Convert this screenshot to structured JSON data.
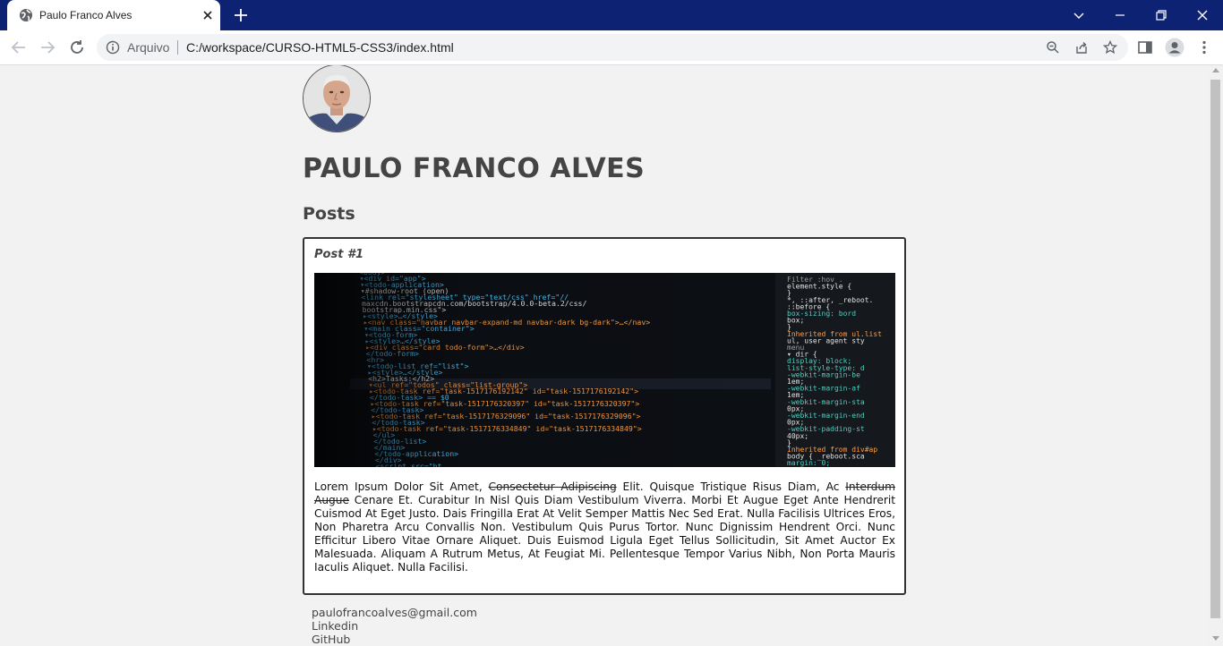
{
  "browser": {
    "tab_title": "Paulo Franco Alves",
    "scheme_label": "Arquivo",
    "url": "C:/workspace/CURSO-HTML5-CSS3/index.html"
  },
  "page": {
    "name": "PAULO FRANCO ALVES",
    "posts_heading": "Posts",
    "post": {
      "title": "Post #1",
      "text_parts": [
        "Lorem Ipsum Dolor Sit Amet, ",
        "Consectetur Adipiscing",
        " Elit. Quisque Tristique Risus Diam, Ac ",
        "Interdum Augue",
        " Cenare Et. Curabitur In Nisl Quis Diam Vestibulum Viverra. Morbi Et Augue Eget Ante Hendrerit Cuismod At Eget Justo. Dais Fringilla Erat At Velit Semper Mattis Nec Sed Erat. Nulla Facilisis Ultrices Eros, Non Pharetra Arcu Convallis Non. Vestibulum Quis Purus Tortor. Nunc Dignissim Hendrent Orci. Nunc Efficitur Libero Vitae Ornare Aliquet. Duis Euismod Ligula Eget Tellus Sollicitudin, Sit Amet Auctor Ex Malesuada. Aliquam A Rutrum Metus, At Feugiat Mi. Pellentesque Tempor Varius Nibh, Non Porta Mauris Iaculis Aliquet. Nulla Facilisi."
      ],
      "code_lines": [
        {
          "text": "<body>",
          "color": "#4fc3f7"
        },
        {
          "text": "▾<div id=\"app\">",
          "color": "#4fc3f7"
        },
        {
          "text": "  ▾<todo-application>",
          "color": "#4fc3f7"
        },
        {
          "text": "    ▾#shadow-root (open)",
          "color": "#e0e0e0"
        },
        {
          "text": "      <link rel=\"stylesheet\" type=\"text/css\" href=\"//",
          "color": "#4fc3f7"
        },
        {
          "text": "      maxcdn.bootstrapcdn.com/bootstrap/4.0.0-beta.2/css/",
          "color": "#e0e0e0"
        },
        {
          "text": "      bootstrap.min.css\">",
          "color": "#e0e0e0"
        },
        {
          "text": "     ▸<style>…</style>",
          "color": "#4fc3f7"
        },
        {
          "text": "     ▸<nav class=\"navbar navbar-expand-md navbar-dark bg-dark\">…</nav>",
          "color": "#ff9e40"
        },
        {
          "text": "     ▾<main class=\"container\">",
          "color": "#4fc3f7"
        },
        {
          "text": "       ▾<todo-form>",
          "color": "#4fc3f7"
        },
        {
          "text": "         ▸<style>…</style>",
          "color": "#4fc3f7"
        },
        {
          "text": "         ▸<div class=\"card todo-form\">…</div>",
          "color": "#ff9e40"
        },
        {
          "text": "        </todo-form>",
          "color": "#4fc3f7"
        },
        {
          "text": "        <hr>",
          "color": "#4fc3f7"
        },
        {
          "text": "       ▾<todo-list ref=\"list\">",
          "color": "#4fc3f7"
        },
        {
          "text": "         ▸<style>…</style>",
          "color": "#4fc3f7"
        },
        {
          "text": "          <h2>Tasks:</h2>",
          "color": "#e0e0e0"
        },
        {
          "text": "         ▾<ul ref=\"todos\" class=\"list-group\">",
          "color": "#ff9e40"
        },
        {
          "text": "           ▸<todo-task ref=\"task-1517176192142\" id=\"task-1517176192142\">",
          "color": "#ff9e40"
        },
        {
          "text": "            </todo-task> == $0",
          "color": "#4fc3f7"
        },
        {
          "text": "           ▸<todo-task ref=\"task-1517176320397\" id=\"task-1517176320397\">",
          "color": "#ff9e40"
        },
        {
          "text": "            </todo-task>",
          "color": "#4fc3f7"
        },
        {
          "text": "           ▸<todo-task ref=\"task-1517176329096\" id=\"task-1517176329096\">",
          "color": "#ff9e40"
        },
        {
          "text": "            </todo-task>",
          "color": "#4fc3f7"
        },
        {
          "text": "           ▸<todo-task ref=\"task-1517176334849\" id=\"task-1517176334849\">",
          "color": "#ff9e40"
        },
        {
          "text": "          </ul>",
          "color": "#4fc3f7"
        },
        {
          "text": "        </todo-list>",
          "color": "#4fc3f7"
        },
        {
          "text": "      </main>",
          "color": "#4fc3f7"
        },
        {
          "text": "    </todo-application>",
          "color": "#4fc3f7"
        },
        {
          "text": "  </div>",
          "color": "#4fc3f7"
        },
        {
          "text": "  <script src=\"ht",
          "color": "#4fc3f7"
        }
      ],
      "side_lines": [
        {
          "text": "Filter         :hov  .",
          "color": "#9e9e9e"
        },
        {
          "text": "element.style {",
          "color": "#e0e0e0"
        },
        {
          "text": "}",
          "color": "#e0e0e0"
        },
        {
          "text": "*, ::after,          _reboot.",
          "color": "#e0e0e0"
        },
        {
          "text": "::before {",
          "color": "#e0e0e0"
        },
        {
          "text": "  box-sizing: bord",
          "color": "#4dd0c0"
        },
        {
          "text": "    box;",
          "color": "#e0e0e0"
        },
        {
          "text": "}",
          "color": "#e0e0e0"
        },
        {
          "text": "Inherited from ul.list",
          "color": "#ff9e40"
        },
        {
          "text": "ul,  user agent sty",
          "color": "#e0e0e0"
        },
        {
          "text": "menu",
          "color": "#9e9e9e"
        },
        {
          "text": "▾ dir {",
          "color": "#e0e0e0"
        },
        {
          "text": "  display: block;",
          "color": "#4dd0c0"
        },
        {
          "text": "  list-style-type: d",
          "color": "#4dd0c0"
        },
        {
          "text": "  -webkit-margin-be",
          "color": "#4dd0c0"
        },
        {
          "text": "    1em;",
          "color": "#e0e0e0"
        },
        {
          "text": "  -webkit-margin-af",
          "color": "#4dd0c0"
        },
        {
          "text": "    1em;",
          "color": "#e0e0e0"
        },
        {
          "text": "  -webkit-margin-sta",
          "color": "#4dd0c0"
        },
        {
          "text": "    0px;",
          "color": "#e0e0e0"
        },
        {
          "text": "  -webkit-margin-end",
          "color": "#4dd0c0"
        },
        {
          "text": "    0px;",
          "color": "#e0e0e0"
        },
        {
          "text": "  -webkit-padding-st",
          "color": "#4dd0c0"
        },
        {
          "text": "    40px;",
          "color": "#e0e0e0"
        },
        {
          "text": "}",
          "color": "#e0e0e0"
        },
        {
          "text": "Inherited from div#ap",
          "color": "#ff9e40"
        },
        {
          "text": "body {      _reboot.sca",
          "color": "#e0e0e0"
        },
        {
          "text": "  margin: 0;",
          "color": "#4dd0c0"
        }
      ]
    },
    "footer": {
      "email": "paulofrancoalves@gmail.com",
      "linkedin": "Linkedin",
      "github": "GitHub"
    }
  }
}
